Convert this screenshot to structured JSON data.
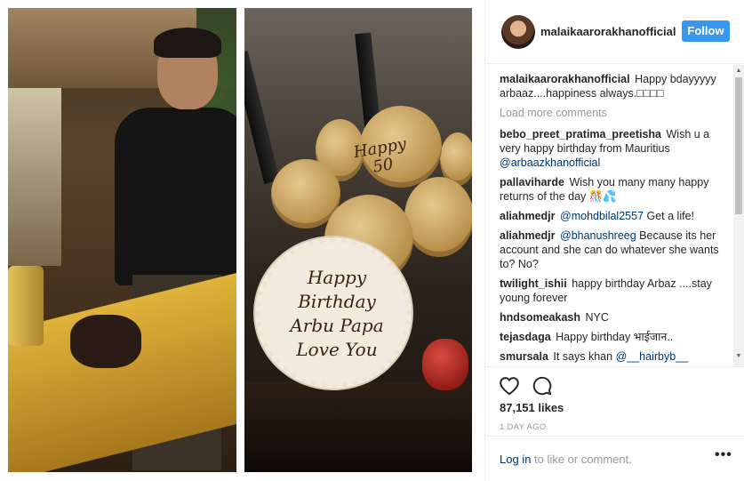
{
  "post": {
    "username": "malaikaarorakhanofficial",
    "follow_label": "Follow",
    "likes": "87,151 likes",
    "timestamp": "1 DAY AGO"
  },
  "photos": {
    "right_plaque_lines": [
      "Happy",
      "Birthday",
      "Arbu Papa",
      "Love You"
    ],
    "right_plaque_small": [
      "Happy",
      "50"
    ]
  },
  "comments": {
    "caption": {
      "user": "malaikaarorakhanofficial",
      "text": "Happy bdayyyyy arbaaz....happiness always.□□□□"
    },
    "load_more": "Load more comments",
    "items": [
      {
        "user": "bebo_preet_pratima_preetisha",
        "text": "Wish u a very happy birthday from Mauritius ",
        "mention": "@arbaazkhanofficial",
        "after": ""
      },
      {
        "user": "pallavihardе",
        "text": "Wish you many many happy returns of the day 🎊💦",
        "mention": "",
        "after": ""
      },
      {
        "user": "aliahmedjr",
        "text": "",
        "mention": "@mohdbilal2557",
        "after": " Get a life!"
      },
      {
        "user": "aliahmedjr",
        "text": "",
        "mention": "@bhanushreeg",
        "after": " Because its her account and she can do whatever she wants to? No?"
      },
      {
        "user": "twilight_ishii",
        "text": "happy birthday Arbaz ....stay young forever",
        "mention": "",
        "after": ""
      },
      {
        "user": "hndsomeakash",
        "text": "NYC",
        "mention": "",
        "after": ""
      },
      {
        "user": "tejasdaga",
        "text": "Happy birthday भाईजान..",
        "mention": "",
        "after": ""
      },
      {
        "user": "smursala",
        "text": "It says khan ",
        "mention": "@__hairbyb__",
        "after": ""
      }
    ]
  },
  "footer": {
    "login_link": "Log in",
    "login_rest": " to like or comment.",
    "more": "•••"
  },
  "icons": {
    "heart": "heart-icon",
    "comment": "comment-icon",
    "scroll_up": "▲",
    "scroll_down": "▼"
  }
}
